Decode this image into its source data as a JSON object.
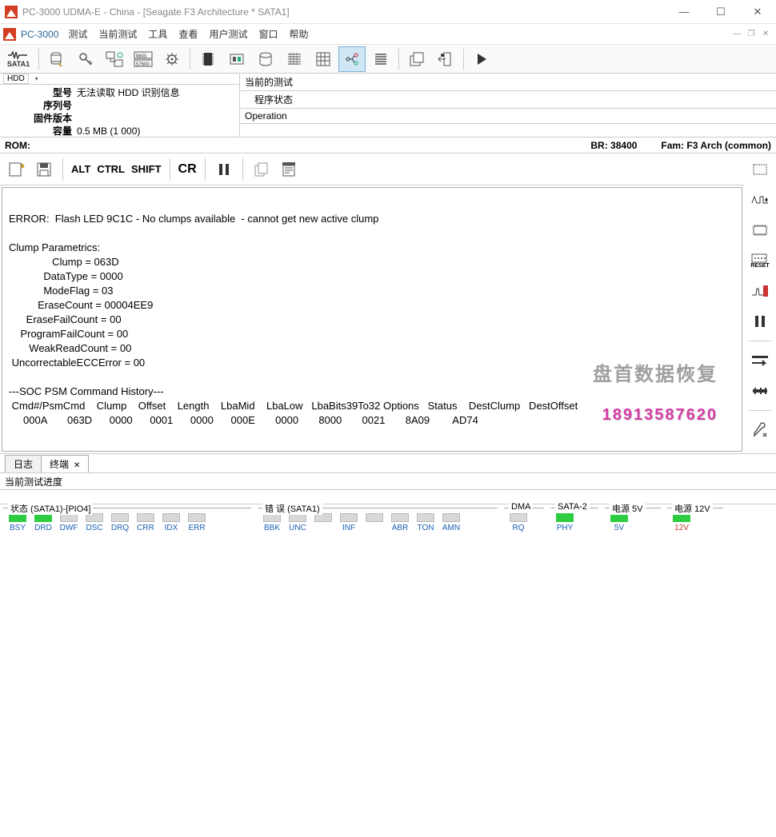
{
  "window": {
    "title": "PC-3000 UDMA-E - China - [Seagate F3 Architecture * SATA1]"
  },
  "menu": {
    "brand": "PC-3000",
    "items": [
      "测试",
      "当前测试",
      "工具",
      "查看",
      "用户测试",
      "窗口",
      "帮助"
    ]
  },
  "hdd_panel": {
    "header": "HDD",
    "model_k": "型号",
    "model_v": "无法读取 HDD 识别信息",
    "serial_k": "序列号",
    "serial_v": "",
    "fw_k": "固件版本",
    "fw_v": "",
    "cap_k": "容量",
    "cap_v": "0.5 MB (1 000)"
  },
  "test_panel": {
    "current": "当前的测试",
    "state": "程序状态",
    "op": "Operation"
  },
  "statrow": {
    "rom": "ROM:",
    "br": "BR: 38400",
    "fam": "Fam: F3 Arch (common)"
  },
  "term_toolbar": {
    "alt": "ALT",
    "ctrl": "CTRL",
    "shift": "SHIFT",
    "cr": "CR",
    "reset": "RESET"
  },
  "terminal_text": "\nERROR:  Flash LED 9C1C - No clumps available  - cannot get new active clump\n\nClump Parametrics:\n               Clump = 063D\n            DataType = 0000\n            ModeFlag = 03\n          EraseCount = 00004EE9\n      EraseFailCount = 00\n    ProgramFailCount = 00\n       WeakReadCount = 00\n UncorrectableECCError = 00\n\n---SOC PSM Command History---\n Cmd#/PsmCmd    Clump    Offset    Length    LbaMid    LbaLow   LbaBits39To32 Options   Status    DestClump   DestOffset\n     000A       063D      0000      0001      0000      000E       0000       8000       0021       8A09        AD74",
  "tabs": {
    "log": "日志",
    "term": "终端"
  },
  "progress_label": "当前测试进度",
  "status": {
    "g1": {
      "title": "状态 (SATA1)-[PIO4]",
      "cols": [
        "BSY",
        "DRD",
        "DWF",
        "DSC",
        "DRQ",
        "CRR",
        "IDX",
        "ERR"
      ],
      "on": [
        1,
        1,
        0,
        0,
        0,
        0,
        0,
        0
      ]
    },
    "g2": {
      "title": "错 误 (SATA1)",
      "cols": [
        "BBK",
        "UNC",
        "",
        "INF",
        "",
        "ABR",
        "TON",
        "AMN"
      ],
      "on": [
        0,
        0,
        0,
        0,
        0,
        0,
        0,
        0
      ]
    },
    "g3": {
      "title": "DMA",
      "cols": [
        "RQ"
      ],
      "on": [
        0
      ]
    },
    "g4": {
      "title": "SATA-2",
      "cols": [
        "PHY"
      ],
      "on": [
        1
      ]
    },
    "g5": {
      "title": "电源 5V",
      "cols": [
        "5V"
      ],
      "on": [
        1
      ]
    },
    "g6": {
      "title": "电源 12V",
      "cols": [
        "12V"
      ],
      "on": [
        1
      ],
      "red": [
        1
      ]
    }
  },
  "watermark": {
    "line1": "盘首数据恢复",
    "line2": "18913587620"
  }
}
